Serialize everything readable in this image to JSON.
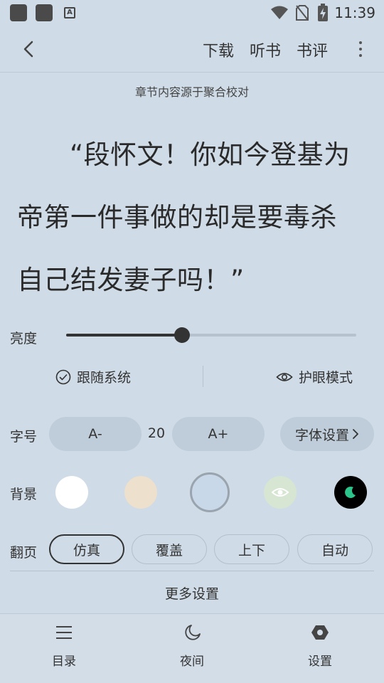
{
  "status_bar": {
    "time": "11:39",
    "icons": [
      "app-icon",
      "app-icon",
      "a-icon",
      "wifi-icon",
      "no-sim-icon",
      "battery-charging-icon"
    ]
  },
  "toolbar": {
    "back_icon": "back-arrow-icon",
    "actions": [
      "下载",
      "听书",
      "书评"
    ],
    "more_icon": "more-vertical-icon"
  },
  "reader": {
    "source_note": "章节内容源于聚合校对",
    "lines": [
      "“段怀文！你如今登基为",
      "帝第一件事做的却是要毒杀",
      "自己结发妻子吗！”"
    ]
  },
  "brightness": {
    "label": "亮度",
    "value": 0.4,
    "follow_system": "跟随系统",
    "eye_care": "护眼模式"
  },
  "font_size": {
    "label": "字号",
    "decrease": "A-",
    "value": "20",
    "increase": "A+",
    "settings": "字体设置"
  },
  "background": {
    "label": "背景",
    "swatches": [
      "#ffffff",
      "#ede0cc",
      "#c9d8e8",
      "#d6e6d2",
      "#000000"
    ],
    "selected_index": 2
  },
  "page_turn": {
    "label": "翻页",
    "options": [
      "仿真",
      "覆盖",
      "上下",
      "自动"
    ],
    "selected_index": 0
  },
  "more_settings": "更多设置",
  "bottom_nav": {
    "items": [
      {
        "label": "目录",
        "icon": "list-icon"
      },
      {
        "label": "夜间",
        "icon": "moon-icon"
      },
      {
        "label": "设置",
        "icon": "settings-hexagon-icon"
      }
    ]
  },
  "colors": {
    "background": "#cfdbe6",
    "text": "#222222",
    "pill": "#bfcdda"
  }
}
